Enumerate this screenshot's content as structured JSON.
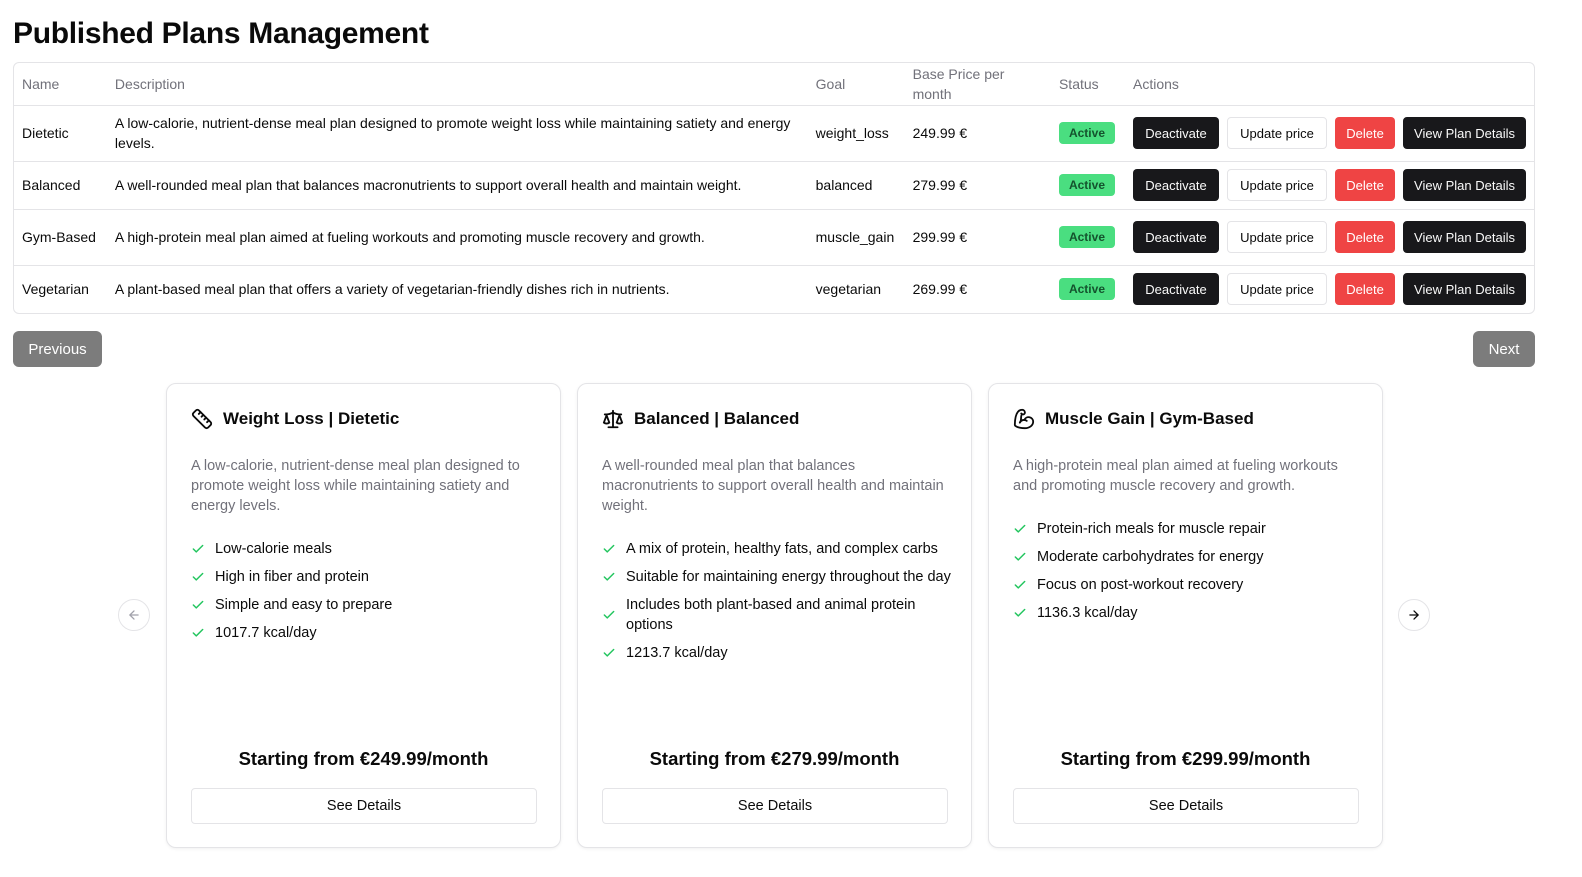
{
  "page": {
    "title": "Published Plans Management"
  },
  "colors": {
    "accent_dark": "#18181b",
    "status_active": "#4ade80",
    "danger": "#ef4444",
    "check": "#22c55e",
    "pager": "#7c7c7c"
  },
  "table": {
    "headers": {
      "name": "Name",
      "description": "Description",
      "goal": "Goal",
      "price": "Base Price per month",
      "status": "Status",
      "actions": "Actions"
    },
    "rows": [
      {
        "name": "Dietetic",
        "description": "A low-calorie, nutrient-dense meal plan designed to promote weight loss while maintaining satiety and energy levels.",
        "goal": "weight_loss",
        "price": "249.99 €",
        "status": "Active"
      },
      {
        "name": "Balanced",
        "description": "A well-rounded meal plan that balances macronutrients to support overall health and maintain weight.",
        "goal": "balanced",
        "price": "279.99 €",
        "status": "Active"
      },
      {
        "name": "Gym-Based",
        "description": "A high-protein meal plan aimed at fueling workouts and promoting muscle recovery and growth.",
        "goal": "muscle_gain",
        "price": "299.99 €",
        "status": "Active"
      },
      {
        "name": "Vegetarian",
        "description": "A plant-based meal plan that offers a variety of vegetarian-friendly dishes rich in nutrients.",
        "goal": "vegetarian",
        "price": "269.99 €",
        "status": "Active"
      }
    ],
    "action_labels": {
      "deactivate": "Deactivate",
      "update_price": "Update price",
      "delete": "Delete",
      "view": "View Plan Details"
    }
  },
  "pagination": {
    "previous": "Previous",
    "next": "Next"
  },
  "cards": [
    {
      "icon": "ruler-icon",
      "title": "Weight Loss | Dietetic",
      "description": "A low-calorie, nutrient-dense meal plan designed to promote weight loss while maintaining satiety and energy levels.",
      "features": [
        "Low-calorie meals",
        "High in fiber and protein",
        "Simple and easy to prepare",
        "1017.7 kcal/day"
      ],
      "price": "Starting from €249.99/month",
      "button": "See Details"
    },
    {
      "icon": "scale-icon",
      "title": "Balanced | Balanced",
      "description": "A well-rounded meal plan that balances macronutrients to support overall health and maintain weight.",
      "features": [
        "A mix of protein, healthy fats, and complex carbs",
        "Suitable for maintaining energy throughout the day",
        "Includes both plant-based and animal protein options",
        "1213.7 kcal/day"
      ],
      "price": "Starting from €279.99/month",
      "button": "See Details"
    },
    {
      "icon": "biceps-icon",
      "title": "Muscle Gain | Gym-Based",
      "description": "A high-protein meal plan aimed at fueling workouts and promoting muscle recovery and growth.",
      "features": [
        "Protein-rich meals for muscle repair",
        "Moderate carbohydrates for energy",
        "Focus on post-workout recovery",
        "1136.3 kcal/day"
      ],
      "price": "Starting from €299.99/month",
      "button": "See Details"
    }
  ]
}
